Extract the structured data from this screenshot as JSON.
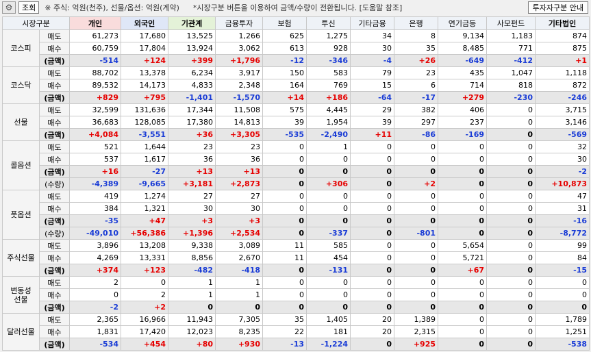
{
  "toolbar": {
    "gear_icon": "gear-icon",
    "query_label": "조회",
    "note": "※ 주식: 억원(천주), 선물/옵션: 억원(계약)",
    "note2": "*시장구분 버튼을 이용하여 금액/수량이 전환됩니다. [도움말 참조]",
    "investor_guide_label": "투자자구분 안내"
  },
  "columns": [
    "시장구분",
    "개인",
    "외국인",
    "기관계",
    "금융투자",
    "보험",
    "투신",
    "기타금융",
    "은행",
    "연기금등",
    "사모펀드",
    "기타법인"
  ],
  "colors": {
    "positive": "#e60000",
    "negative": "#1a3cd6",
    "header_bg": "#eef2f7"
  },
  "rows": [
    {
      "cat": "코스피",
      "span": 3,
      "kind": "매도",
      "type": "n",
      "vals": [
        "61,273",
        "17,680",
        "13,525",
        "1,266",
        "625",
        "1,275",
        "34",
        "8",
        "9,134",
        "1,183",
        "874"
      ]
    },
    {
      "kind": "매수",
      "type": "n",
      "vals": [
        "60,759",
        "17,804",
        "13,924",
        "3,062",
        "613",
        "928",
        "30",
        "35",
        "8,485",
        "771",
        "875"
      ]
    },
    {
      "kind": "(금액)",
      "type": "s",
      "vals": [
        "-514",
        "+124",
        "+399",
        "+1,796",
        "-12",
        "-346",
        "-4",
        "+26",
        "-649",
        "-412",
        "+1"
      ]
    },
    {
      "cat": "코스닥",
      "span": 3,
      "kind": "매도",
      "type": "n",
      "vals": [
        "88,702",
        "13,378",
        "6,234",
        "3,917",
        "150",
        "583",
        "79",
        "23",
        "435",
        "1,047",
        "1,118"
      ]
    },
    {
      "kind": "매수",
      "type": "n",
      "vals": [
        "89,532",
        "14,173",
        "4,833",
        "2,348",
        "164",
        "769",
        "15",
        "6",
        "714",
        "818",
        "872"
      ]
    },
    {
      "kind": "(금액)",
      "type": "s",
      "vals": [
        "+829",
        "+795",
        "-1,401",
        "-1,570",
        "+14",
        "+186",
        "-64",
        "-17",
        "+279",
        "-230",
        "-246"
      ]
    },
    {
      "cat": "선물",
      "span": 3,
      "kind": "매도",
      "type": "n",
      "vals": [
        "32,599",
        "131,636",
        "17,344",
        "11,508",
        "575",
        "4,445",
        "29",
        "382",
        "406",
        "0",
        "3,715"
      ]
    },
    {
      "kind": "매수",
      "type": "n",
      "vals": [
        "36,683",
        "128,085",
        "17,380",
        "14,813",
        "39",
        "1,954",
        "39",
        "297",
        "237",
        "0",
        "3,146"
      ]
    },
    {
      "kind": "(금액)",
      "type": "s",
      "vals": [
        "+4,084",
        "-3,551",
        "+36",
        "+3,305",
        "-535",
        "-2,490",
        "+11",
        "-86",
        "-169",
        "0",
        "-569"
      ]
    },
    {
      "cat": "콜옵션",
      "span": 4,
      "kind": "매도",
      "type": "n",
      "vals": [
        "521",
        "1,644",
        "23",
        "23",
        "0",
        "1",
        "0",
        "0",
        "0",
        "0",
        "32"
      ]
    },
    {
      "kind": "매수",
      "type": "n",
      "vals": [
        "537",
        "1,617",
        "36",
        "36",
        "0",
        "0",
        "0",
        "0",
        "0",
        "0",
        "30"
      ]
    },
    {
      "kind": "(금액)",
      "type": "s",
      "vals": [
        "+16",
        "-27",
        "+13",
        "+13",
        "0",
        "0",
        "0",
        "0",
        "0",
        "0",
        "-2"
      ]
    },
    {
      "kind": "(수량)",
      "type": "q",
      "vals": [
        "-4,389",
        "-9,665",
        "+3,181",
        "+2,873",
        "0",
        "+306",
        "0",
        "+2",
        "0",
        "0",
        "+10,873"
      ]
    },
    {
      "cat": "풋옵션",
      "span": 4,
      "kind": "매도",
      "type": "n",
      "vals": [
        "419",
        "1,274",
        "27",
        "27",
        "0",
        "0",
        "0",
        "0",
        "0",
        "0",
        "47"
      ]
    },
    {
      "kind": "매수",
      "type": "n",
      "vals": [
        "384",
        "1,321",
        "30",
        "30",
        "0",
        "0",
        "0",
        "0",
        "0",
        "0",
        "31"
      ]
    },
    {
      "kind": "(금액)",
      "type": "s",
      "vals": [
        "-35",
        "+47",
        "+3",
        "+3",
        "0",
        "0",
        "0",
        "0",
        "0",
        "0",
        "-16"
      ]
    },
    {
      "kind": "(수량)",
      "type": "q",
      "vals": [
        "-49,010",
        "+56,386",
        "+1,396",
        "+2,534",
        "0",
        "-337",
        "0",
        "-801",
        "0",
        "0",
        "-8,772"
      ]
    },
    {
      "cat": "주식선물",
      "span": 3,
      "kind": "매도",
      "type": "n",
      "vals": [
        "3,896",
        "13,208",
        "9,338",
        "3,089",
        "11",
        "585",
        "0",
        "0",
        "5,654",
        "0",
        "99"
      ]
    },
    {
      "kind": "매수",
      "type": "n",
      "vals": [
        "4,269",
        "13,331",
        "8,856",
        "2,670",
        "11",
        "454",
        "0",
        "0",
        "5,721",
        "0",
        "84"
      ]
    },
    {
      "kind": "(금액)",
      "type": "s",
      "vals": [
        "+374",
        "+123",
        "-482",
        "-418",
        "0",
        "-131",
        "0",
        "0",
        "+67",
        "0",
        "-15"
      ]
    },
    {
      "cat": "변동성\n선물",
      "span": 3,
      "kind": "매도",
      "type": "n",
      "vals": [
        "2",
        "0",
        "1",
        "1",
        "0",
        "0",
        "0",
        "0",
        "0",
        "0",
        "0"
      ]
    },
    {
      "kind": "매수",
      "type": "n",
      "vals": [
        "0",
        "2",
        "1",
        "1",
        "0",
        "0",
        "0",
        "0",
        "0",
        "0",
        "0"
      ]
    },
    {
      "kind": "(금액)",
      "type": "s",
      "vals": [
        "-2",
        "+2",
        "0",
        "0",
        "0",
        "0",
        "0",
        "0",
        "0",
        "0",
        "0"
      ]
    },
    {
      "cat": "달러선물",
      "span": 3,
      "kind": "매도",
      "type": "n",
      "vals": [
        "2,365",
        "16,966",
        "11,943",
        "7,305",
        "35",
        "1,405",
        "20",
        "1,389",
        "0",
        "0",
        "1,789"
      ]
    },
    {
      "kind": "매수",
      "type": "n",
      "vals": [
        "1,831",
        "17,420",
        "12,023",
        "8,235",
        "22",
        "181",
        "20",
        "2,315",
        "0",
        "0",
        "1,251"
      ]
    },
    {
      "kind": "(금액)",
      "type": "s",
      "vals": [
        "-534",
        "+454",
        "+80",
        "+930",
        "-13",
        "-1,224",
        "0",
        "+925",
        "0",
        "0",
        "-538"
      ]
    }
  ]
}
